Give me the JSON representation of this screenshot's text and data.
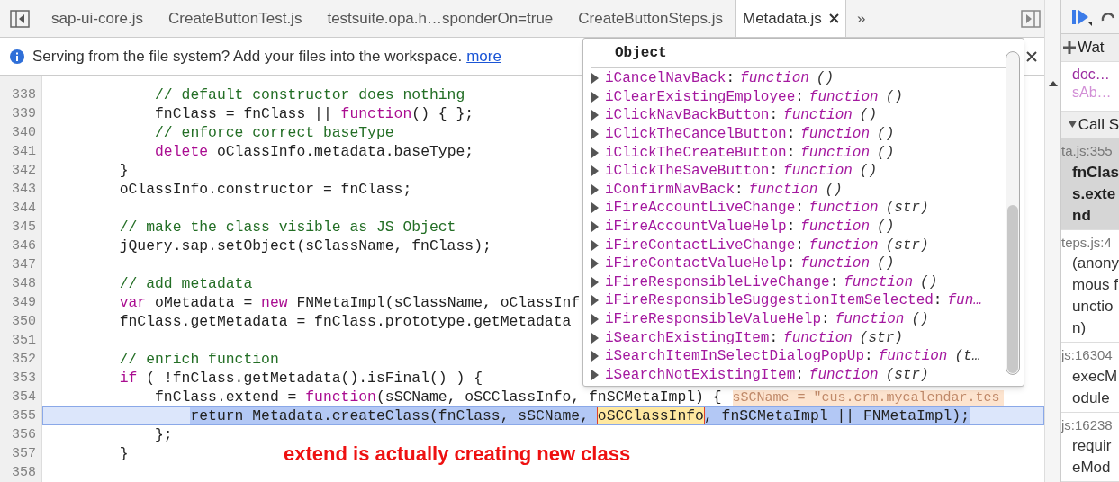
{
  "tabs": [
    {
      "label": "sap-ui-core.js",
      "selected": false,
      "closable": false
    },
    {
      "label": "CreateButtonTest.js",
      "selected": false,
      "closable": false
    },
    {
      "label": "testsuite.opa.h…sponderOn=true",
      "selected": false,
      "closable": false
    },
    {
      "label": "CreateButtonSteps.js",
      "selected": false,
      "closable": false
    },
    {
      "label": "Metadata.js",
      "selected": true,
      "closable": true
    }
  ],
  "tab_overflow": "»",
  "info_bar": {
    "message": "Serving from the file system? Add your files into the workspace.",
    "link": "more"
  },
  "code_lines": [
    {
      "number": "338",
      "selected": false,
      "tokens": [
        {
          "kind": "comment",
          "text": "            // default constructor does nothing"
        }
      ]
    },
    {
      "number": "339",
      "selected": false,
      "tokens": [
        {
          "kind": "plain",
          "text": "            fnClass = fnClass || "
        },
        {
          "kind": "keyword",
          "text": "function"
        },
        {
          "kind": "plain",
          "text": "() { };"
        }
      ]
    },
    {
      "number": "340",
      "selected": false,
      "tokens": [
        {
          "kind": "comment",
          "text": "            // enforce correct baseType"
        }
      ]
    },
    {
      "number": "341",
      "selected": false,
      "tokens": [
        {
          "kind": "keyword",
          "text": "            delete"
        },
        {
          "kind": "plain",
          "text": " oClassInfo.metadata.baseType;"
        }
      ]
    },
    {
      "number": "342",
      "selected": false,
      "tokens": [
        {
          "kind": "plain",
          "text": "        }"
        }
      ]
    },
    {
      "number": "343",
      "selected": false,
      "tokens": [
        {
          "kind": "plain",
          "text": "        oClassInfo.constructor = fnClass;"
        }
      ]
    },
    {
      "number": "344",
      "selected": false
    },
    {
      "number": "345",
      "selected": false,
      "tokens": [
        {
          "kind": "comment",
          "text": "        // make the class visible as JS Object"
        }
      ]
    },
    {
      "number": "346",
      "selected": false,
      "tokens": [
        {
          "kind": "plain",
          "text": "        jQuery.sap.setObject(sClassName, fnClass);"
        }
      ]
    },
    {
      "number": "347",
      "selected": false
    },
    {
      "number": "348",
      "selected": false,
      "tokens": [
        {
          "kind": "comment",
          "text": "        // add metadata"
        }
      ]
    },
    {
      "number": "349",
      "selected": false,
      "tokens": [
        {
          "kind": "keyword",
          "text": "        var"
        },
        {
          "kind": "plain",
          "text": " oMetadata = "
        },
        {
          "kind": "keyword",
          "text": "new"
        },
        {
          "kind": "plain",
          "text": " FNMetaImpl(sClassName, oClassInf"
        }
      ]
    },
    {
      "number": "350",
      "selected": false,
      "tokens": [
        {
          "kind": "plain",
          "text": "        fnClass.getMetadata = fnClass.prototype.getMetadata"
        }
      ]
    },
    {
      "number": "351",
      "selected": false
    },
    {
      "number": "352",
      "selected": false,
      "tokens": [
        {
          "kind": "comment",
          "text": "        // enrich function"
        }
      ]
    },
    {
      "number": "353",
      "selected": false,
      "tokens": [
        {
          "kind": "keyword",
          "text": "        if"
        },
        {
          "kind": "plain",
          "text": " ( !fnClass.getMetadata().isFinal() ) {"
        }
      ]
    },
    {
      "number": "354",
      "selected": false,
      "tokens": [
        {
          "kind": "plain",
          "text": "            fnClass.extend = "
        },
        {
          "kind": "keyword",
          "text": "function"
        },
        {
          "kind": "plain",
          "text": "(sSCName, oSCClassInfo, fnSCMetaImpl) {"
        },
        {
          "kind": "inline_value",
          "text": "sSCName = \"cus.crm.mycalendar.tes"
        }
      ]
    },
    {
      "number": "355",
      "selected": true,
      "tokens": [
        {
          "kind": "selection",
          "text": "                return Metadata.createClass(fnClass, sSCName, "
        },
        {
          "kind": "hover",
          "text": "oSCClassInfo"
        },
        {
          "kind": "selection",
          "text": ", fnSCMetaImpl || FNMetaImpl);"
        }
      ]
    },
    {
      "number": "356",
      "selected": false,
      "tokens": [
        {
          "kind": "plain",
          "text": "            };"
        }
      ]
    },
    {
      "number": "357",
      "selected": false,
      "tokens": [
        {
          "kind": "plain",
          "text": "        }"
        }
      ]
    },
    {
      "number": "358",
      "selected": false
    }
  ],
  "annotation": "extend is actually creating new class",
  "popover": {
    "title": "Object",
    "items": [
      {
        "name": "iCancelNavBack",
        "sep": ":",
        "type": "function",
        "args": "()"
      },
      {
        "name": "iClearExistingEmployee",
        "sep": ":",
        "type": "function",
        "args": "()"
      },
      {
        "name": "iClickNavBackButton",
        "sep": ":",
        "type": "function",
        "args": "()"
      },
      {
        "name": "iClickTheCancelButton",
        "sep": ":",
        "type": "function",
        "args": "()"
      },
      {
        "name": "iClickTheCreateButton",
        "sep": ":",
        "type": "function",
        "args": "()"
      },
      {
        "name": "iClickTheSaveButton",
        "sep": ":",
        "type": "function",
        "args": "()"
      },
      {
        "name": "iConfirmNavBack",
        "sep": ":",
        "type": "function",
        "args": "()"
      },
      {
        "name": "iFireAccountLiveChange",
        "sep": ":",
        "type": "function",
        "args": "(str)"
      },
      {
        "name": "iFireAccountValueHelp",
        "sep": ":",
        "type": "function",
        "args": "()"
      },
      {
        "name": "iFireContactLiveChange",
        "sep": ":",
        "type": "function",
        "args": "(str)"
      },
      {
        "name": "iFireContactValueHelp",
        "sep": ":",
        "type": "function",
        "args": "()"
      },
      {
        "name": "iFireResponsibleLiveChange",
        "sep": ":",
        "type": "function",
        "args": "()"
      },
      {
        "name": "iFireResponsibleSuggestionItemSelected",
        "sep": ":",
        "type": "fun…"
      },
      {
        "name": "iFireResponsibleValueHelp",
        "sep": ":",
        "type": "function",
        "args": "()"
      },
      {
        "name": "iSearchExistingItem",
        "sep": ":",
        "type": "function",
        "args": "(str)"
      },
      {
        "name": "iSearchItemInSelectDialogPopUp",
        "sep": ":",
        "type": "function",
        "args": "(t…"
      },
      {
        "name": "iSearchNotExistingItem",
        "sep": ":",
        "type": "function",
        "args": "(str)"
      }
    ]
  },
  "sidebar": {
    "watch_title": "Wat",
    "watch_items": [
      {
        "text": "doc…",
        "dim": false
      },
      {
        "text": "sAb…",
        "dim": true
      }
    ],
    "call_stack_title": "Call S",
    "frames": [
      {
        "location": "ta.js:355",
        "function": "fnClass.extend",
        "selected": true
      },
      {
        "location": "teps.js:4",
        "function": "(anonymous function)",
        "selected": false
      },
      {
        "location": "js:16304",
        "function": "execModule",
        "selected": false
      },
      {
        "location": "js:16238",
        "function": "requireMod",
        "selected": false
      }
    ]
  }
}
